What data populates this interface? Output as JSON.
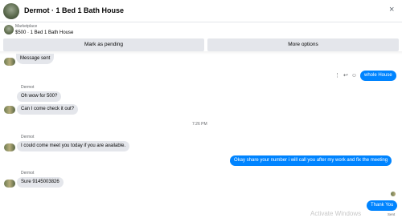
{
  "header": {
    "title": "Dermot · 1 Bed 1 Bath House",
    "close_glyph": "×"
  },
  "listing": {
    "source": "Marketplace",
    "price_title": "$500 · 1 Bed 1 Bath House"
  },
  "actions": {
    "mark_pending": "Mark as pending",
    "more_options": "More options"
  },
  "messages": {
    "top_partial": "Message sent",
    "tool_icons": [
      "⋮",
      "↩",
      "☺"
    ],
    "out_1": "whole House",
    "sender_1": "Dermot",
    "in_1": "Oh wow for 500?",
    "in_2": "Can I come check it out?",
    "timestamp": "7:26 PM",
    "sender_2": "Dermot",
    "in_3": "I could come meet you today if you are available.",
    "out_2": "Okay share your number i will call you after my work and fix the meeting",
    "sender_3": "Dermot",
    "in_4": "Sure 9145003826",
    "out_3": "Thank You",
    "sent_label": "Sent"
  },
  "overlay": {
    "activate_windows": "Activate Windows"
  },
  "colors": {
    "accent_blue": "#0084ff",
    "incoming_bubble": "#e4e6eb",
    "button_gray": "#e4e6eb"
  }
}
